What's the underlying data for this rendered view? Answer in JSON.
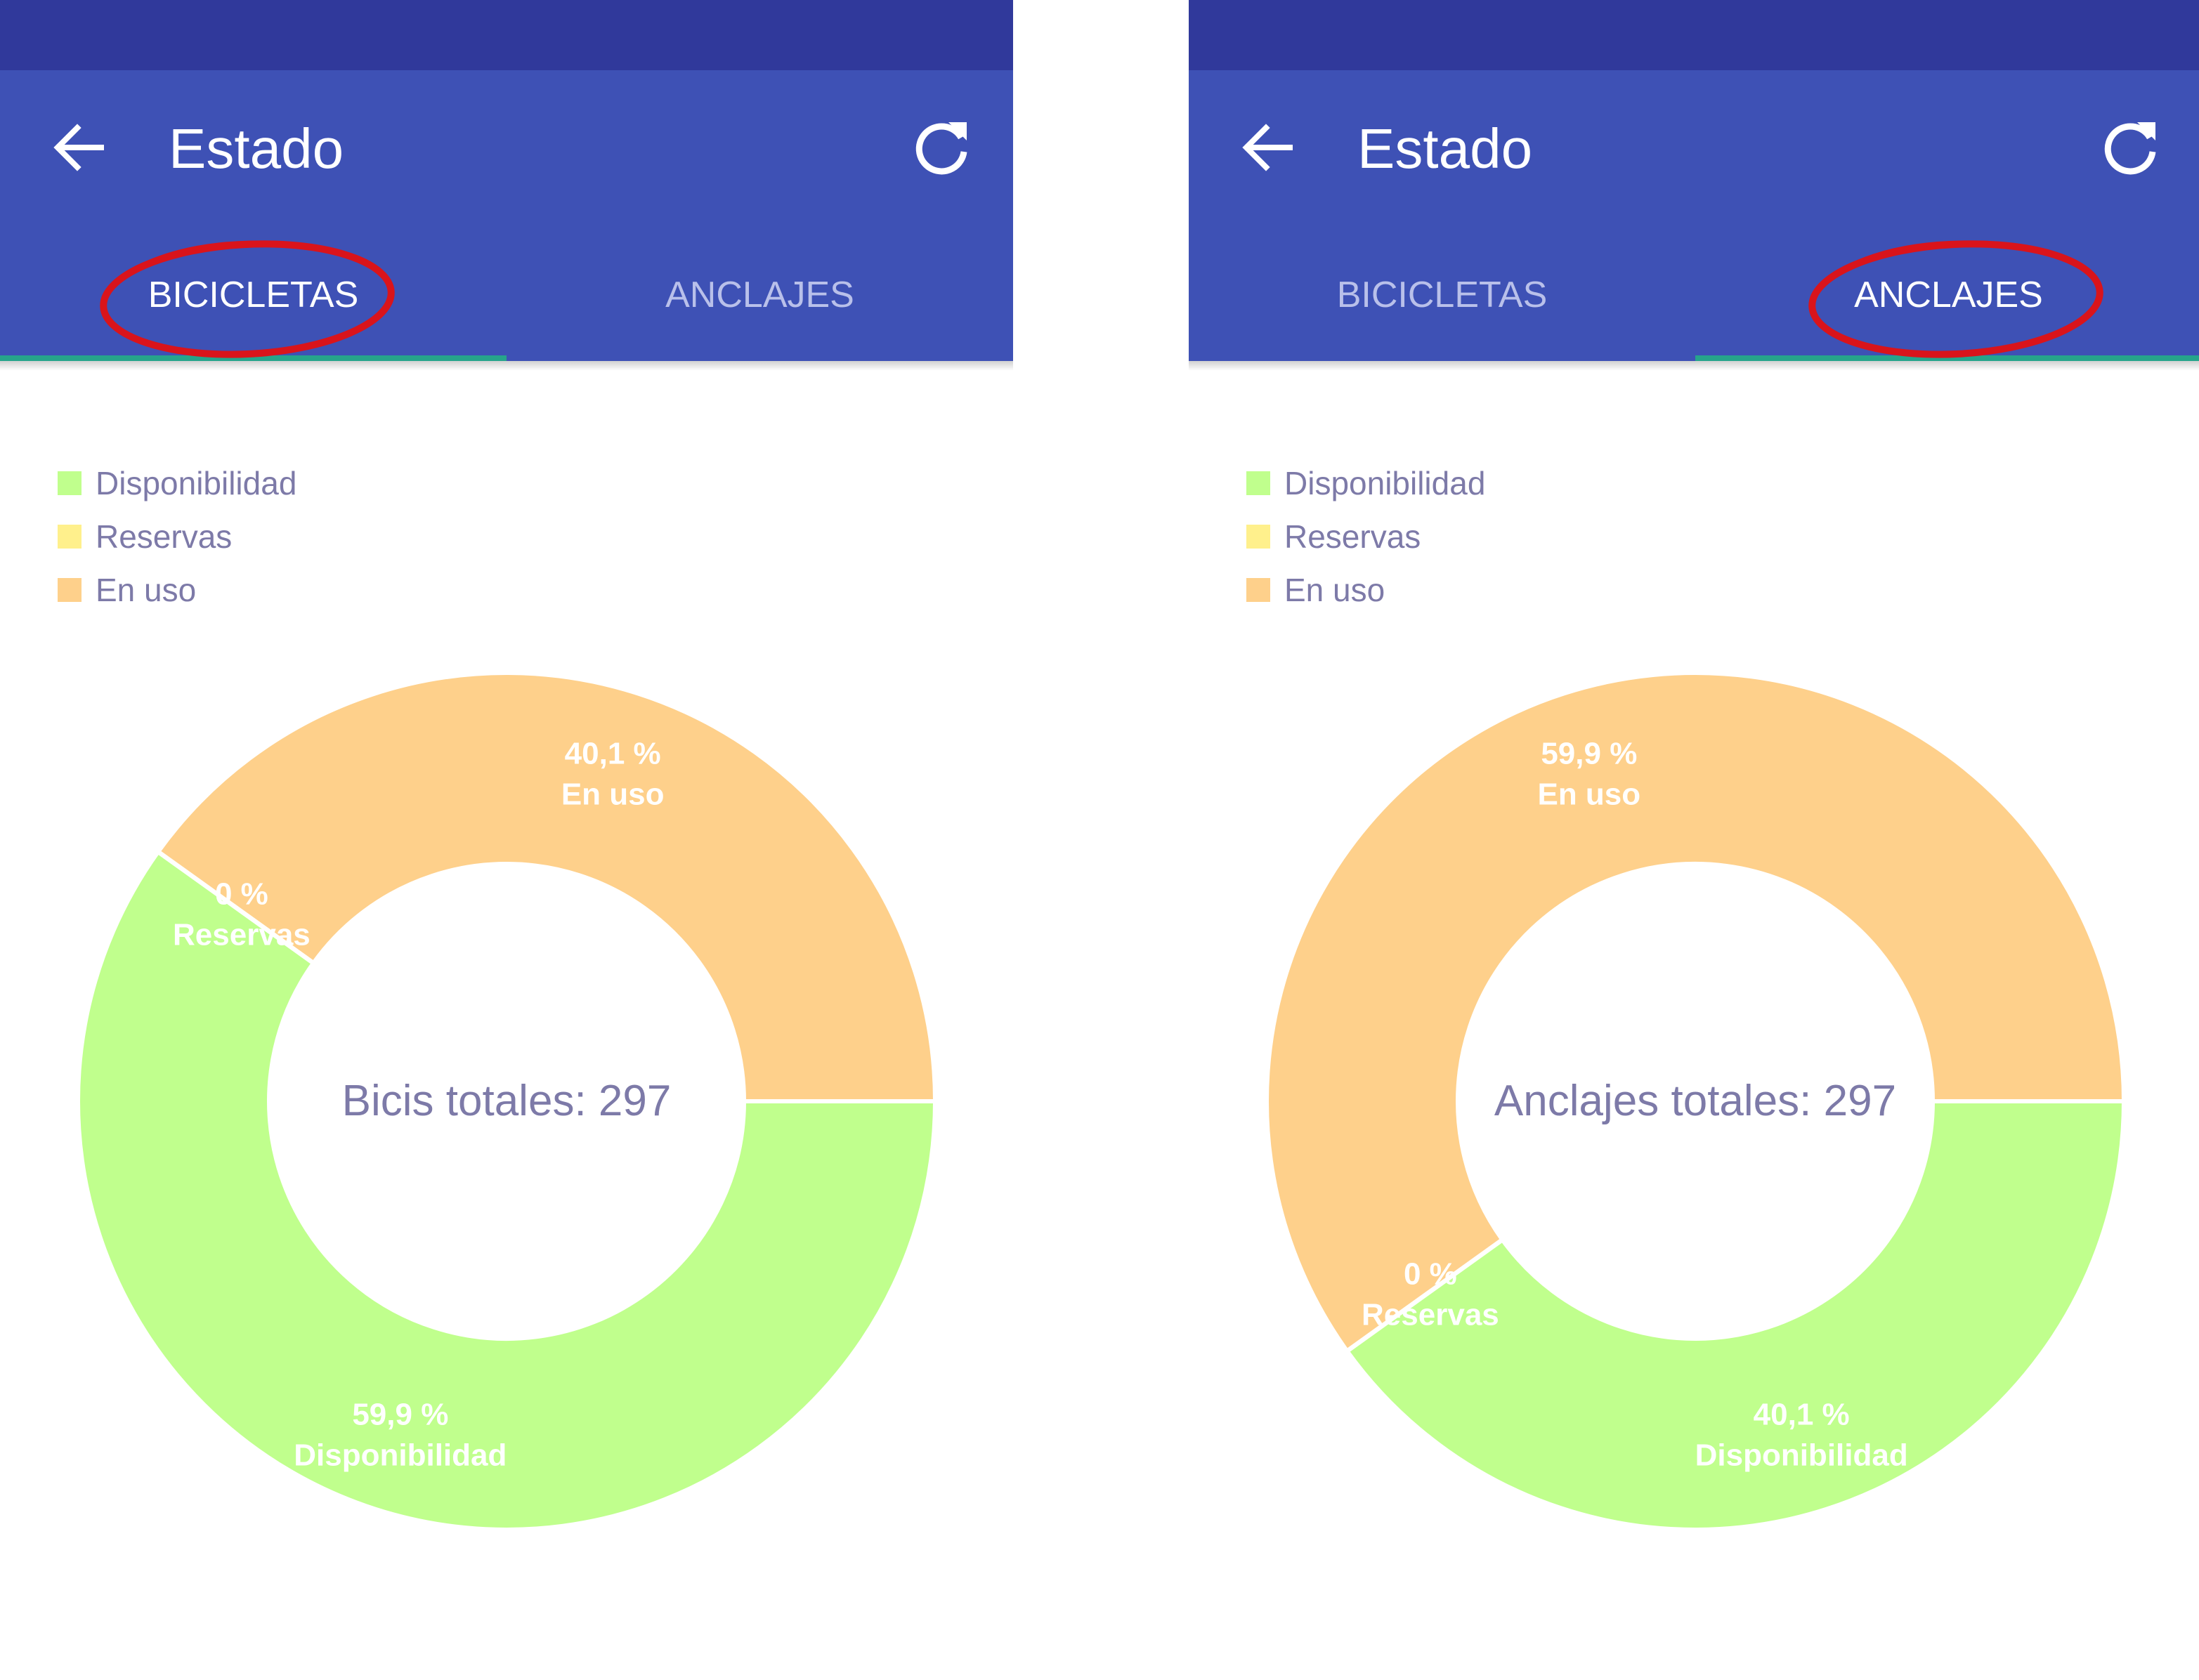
{
  "colors": {
    "status_bar": "#30399b",
    "app_bar": "#3e51b5",
    "tab_indicator": "#26a48b",
    "annotation_circle": "#d9141b",
    "disponibilidad": "#c0ff8d",
    "reservas": "#fff08c",
    "en_uso": "#fed08b",
    "legend_text": "#7d7aa8"
  },
  "screens": [
    {
      "appbar": {
        "title": "Estado",
        "back_icon": "arrow-left-icon",
        "refresh_icon": "refresh-icon"
      },
      "tabs": [
        {
          "label": "BICICLETAS",
          "active": true,
          "circled": true
        },
        {
          "label": "ANCLAJES",
          "active": false,
          "circled": false
        }
      ],
      "legend": [
        {
          "label": "Disponibilidad",
          "color": "#c0ff8d"
        },
        {
          "label": "Reservas",
          "color": "#fff08c"
        },
        {
          "label": "En uso",
          "color": "#fed08b"
        }
      ],
      "center_label": "Bicis totales: 297"
    },
    {
      "appbar": {
        "title": "Estado",
        "back_icon": "arrow-left-icon",
        "refresh_icon": "refresh-icon"
      },
      "tabs": [
        {
          "label": "BICICLETAS",
          "active": false,
          "circled": false
        },
        {
          "label": "ANCLAJES",
          "active": true,
          "circled": true
        }
      ],
      "legend": [
        {
          "label": "Disponibilidad",
          "color": "#c0ff8d"
        },
        {
          "label": "Reservas",
          "color": "#fff08c"
        },
        {
          "label": "En uso",
          "color": "#fed08b"
        }
      ],
      "center_label": "Anclajes totales: 297"
    }
  ],
  "chart_data": [
    {
      "type": "pie",
      "subtype": "donut",
      "center_text": "Bicis totales: 297",
      "slices": [
        {
          "label": "Disponibilidad",
          "value": 59.9,
          "value_label": "59,9 %",
          "color": "#c0ff8d"
        },
        {
          "label": "Reservas",
          "value": 0,
          "value_label": "0 %",
          "color": "#fff08c"
        },
        {
          "label": "En uso",
          "value": 40.1,
          "value_label": "40,1 %",
          "color": "#fed08b"
        }
      ],
      "legend": "top-left"
    },
    {
      "type": "pie",
      "subtype": "donut",
      "center_text": "Anclajes totales: 297",
      "slices": [
        {
          "label": "Disponibilidad",
          "value": 40.1,
          "value_label": "40,1 %",
          "color": "#c0ff8d"
        },
        {
          "label": "Reservas",
          "value": 0,
          "value_label": "0 %",
          "color": "#fff08c"
        },
        {
          "label": "En uso",
          "value": 59.9,
          "value_label": "59,9 %",
          "color": "#fed08b"
        }
      ],
      "legend": "top-left"
    }
  ]
}
